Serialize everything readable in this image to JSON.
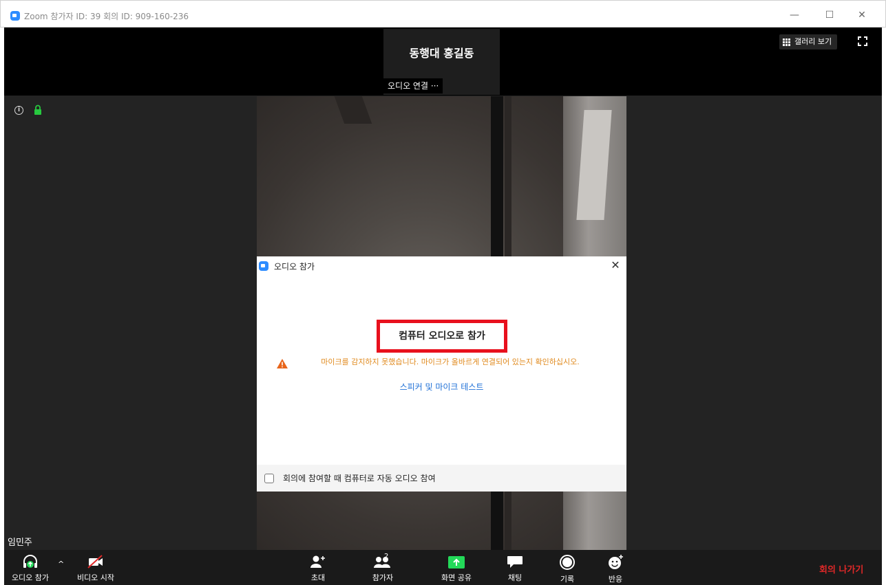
{
  "window": {
    "title": "Zoom 참가자 ID: 39   회의 ID: 909-160-236",
    "minimize": "—",
    "maximize": "☐",
    "close": "✕"
  },
  "meeting": {
    "speaker_name": "동행대 홍길동",
    "audio_status": "오디오 연결 ···",
    "gallery_label": "갤러리 보기",
    "participant_name": "임민주"
  },
  "dialog": {
    "title": "오디오 참가",
    "close": "✕",
    "join_button": "컴퓨터 오디오로 참가",
    "warning": "마이크를 감지하지 못했습니다. 마이크가 올바르게 연결되어 있는지 확인하십시오.",
    "test_link": "스피커 및 마이크 테스트",
    "auto_join_label": "회의에 참여할 때 컴퓨터로 자동 오디오 참여",
    "auto_join_checked": false
  },
  "toolbar": {
    "audio_label": "오디오 참가",
    "caret": "^",
    "video_label": "비디오 시작",
    "invite_label": "초대",
    "participants_label": "참가자",
    "participants_count": "2",
    "share_label": "화면 공유",
    "chat_label": "채팅",
    "record_label": "기록",
    "reactions_label": "반응",
    "leave_label": "회의 나가기"
  },
  "colors": {
    "zoom_blue": "#2d8cff",
    "highlight_red": "#e8101d",
    "warning_orange": "#e08a1e",
    "link_blue": "#1d6fd6",
    "share_green": "#23d959",
    "leave_red": "#e02828",
    "lock_green": "#27c93f"
  }
}
